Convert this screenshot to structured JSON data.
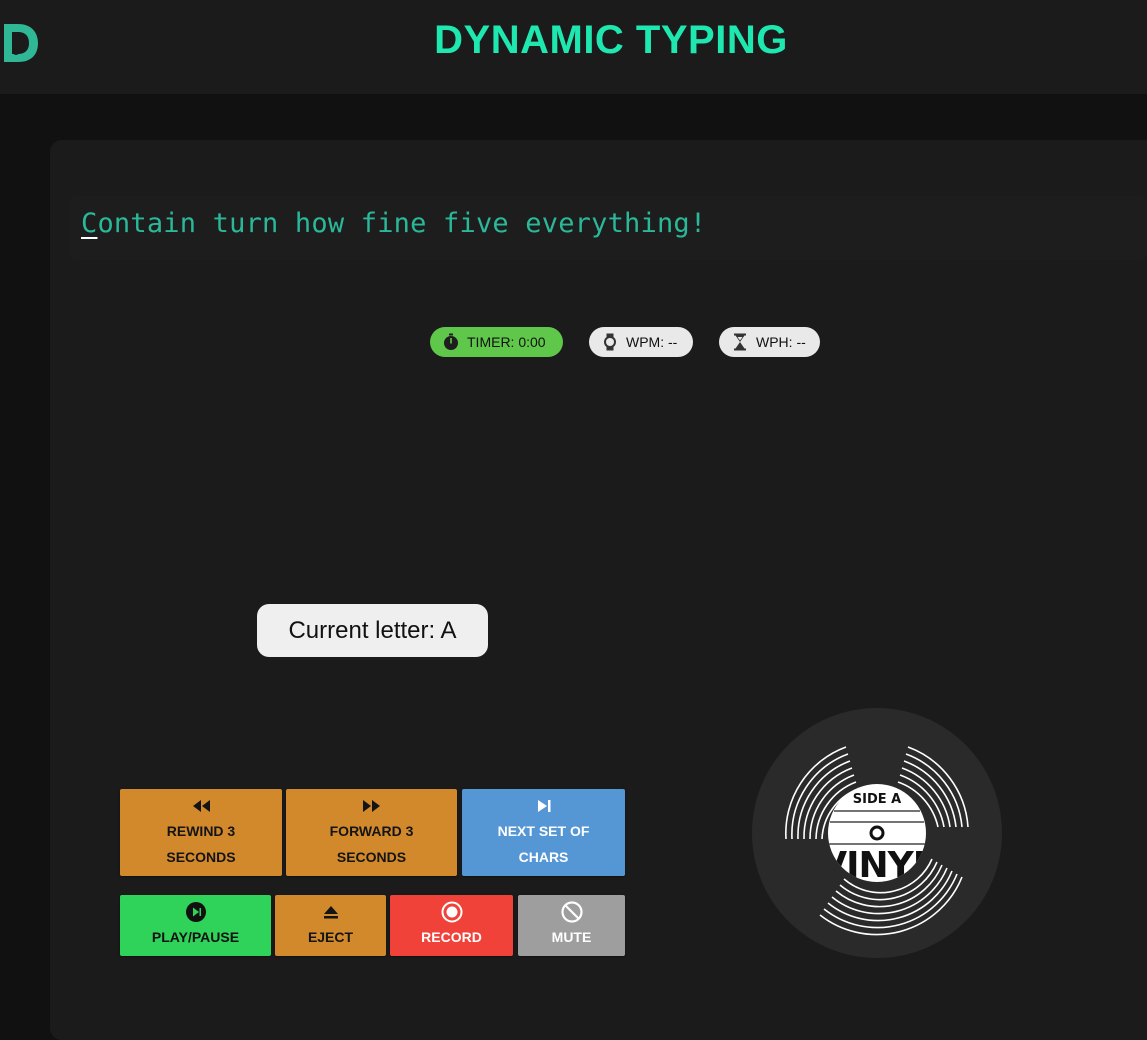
{
  "header": {
    "logo_letter": "D",
    "title": "DYNAMIC TYPING"
  },
  "sentence": {
    "first_char": "C",
    "rest": "ontain turn how fine five everything!"
  },
  "stats": {
    "timer": "TIMER: 0:00",
    "wpm": "WPM: --",
    "wph": "WPH: --"
  },
  "current_letter": "Current letter: A",
  "controls": {
    "rewind": {
      "line1": "REWIND 3",
      "line2": "SECONDS"
    },
    "forward": {
      "line1": "FORWARD 3",
      "line2": "SECONDS"
    },
    "next": {
      "line1": "NEXT SET OF",
      "line2": "CHARS"
    },
    "play_pause": "PLAY/PAUSE",
    "eject": "EJECT",
    "record": "RECORD",
    "mute": "MUTE"
  },
  "vinyl": {
    "side": "SIDE A",
    "label": "VINYL"
  },
  "colors": {
    "accent": "#1ee8b0",
    "sentence_text": "#2bb89a",
    "timer_bg": "#5fc84a",
    "orange": "#d1892c",
    "blue": "#5597d5",
    "green": "#2fd35a",
    "red": "#f1423a",
    "grey": "#9e9e9e"
  }
}
